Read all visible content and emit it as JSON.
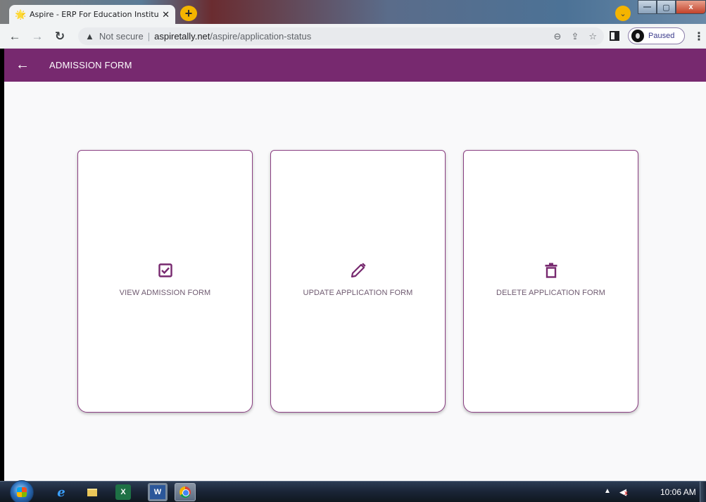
{
  "browser": {
    "tab": {
      "title": "Aspire - ERP For Education Institu",
      "favicon": "🌟",
      "close": "✕"
    },
    "new_tab": "+",
    "tab_search": "⌄",
    "window_controls": {
      "minimize": "—",
      "maximize": "▢",
      "close": "x"
    },
    "nav": {
      "back": "←",
      "forward": "→",
      "reload": "↻"
    },
    "address": {
      "warning_icon": "▲",
      "security_text": "Not secure",
      "separator": "|",
      "host": "aspiretally.net",
      "path": "/aspire/application-status",
      "zoom_icon": "⊖",
      "share_icon": "⇪",
      "bookmark_icon": "☆"
    },
    "profile": {
      "label": "Paused"
    },
    "menu": "⋮"
  },
  "app": {
    "header": {
      "back": "←",
      "title": "ADMISSION FORM"
    },
    "accent_color": "#77296f",
    "cards": [
      {
        "icon": "check-square-icon",
        "label": "VIEW ADMISSION FORM"
      },
      {
        "icon": "pencil-icon",
        "label": "UPDATE APPLICATION FORM"
      },
      {
        "icon": "trash-icon",
        "label": "DELETE APPLICATION FORM"
      }
    ]
  },
  "taskbar": {
    "apps": [
      "ie-icon",
      "folder-icon",
      "excel-icon",
      "word-icon",
      "chrome-icon"
    ],
    "excel_letter": "X",
    "word_letter": "W",
    "ie_letter": "e",
    "tray_arrow": "▲",
    "sound_icon": "◀",
    "muted_mark": "x",
    "clock": "10:06 AM"
  }
}
